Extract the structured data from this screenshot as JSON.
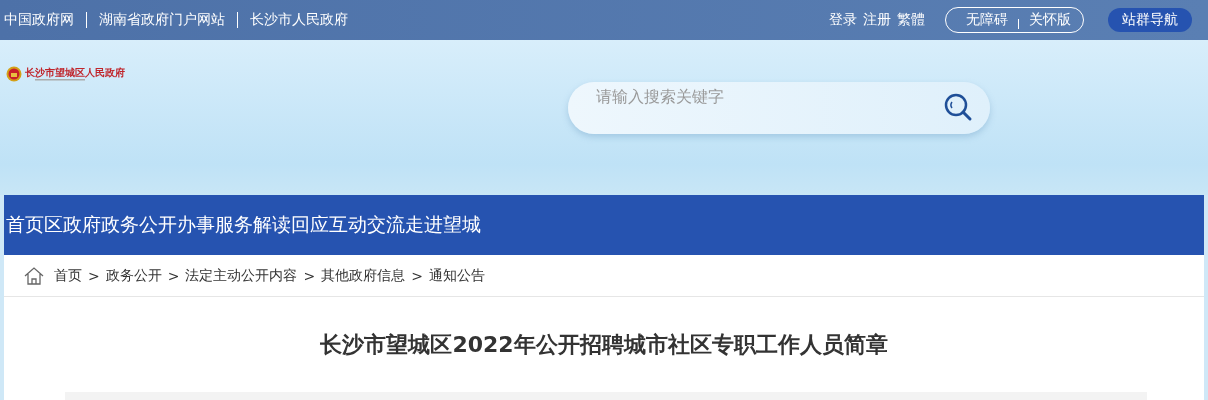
{
  "top_links": [
    "中国政府网",
    "湖南省政府门户网站",
    "长沙市人民政府"
  ],
  "account_links": [
    "登录",
    "注册",
    "繁體"
  ],
  "access_modes": [
    "无障碍",
    "关怀版"
  ],
  "site_nav_button": "站群导航",
  "logo": {
    "name": "长沙市望城区人民政府"
  },
  "search": {
    "placeholder": "请输入搜索关键字"
  },
  "main_nav": [
    "首页",
    "区政府",
    "政务公开",
    "办事服务",
    "解读回应",
    "互动交流",
    "走进望城"
  ],
  "breadcrumb": [
    "首页",
    "政务公开",
    "法定主动公开内容",
    "其他政府信息",
    "通知公告"
  ],
  "breadcrumb_separator": ">",
  "article": {
    "title": "长沙市望城区2022年公开招聘城市社区专职工作人员简章"
  }
}
